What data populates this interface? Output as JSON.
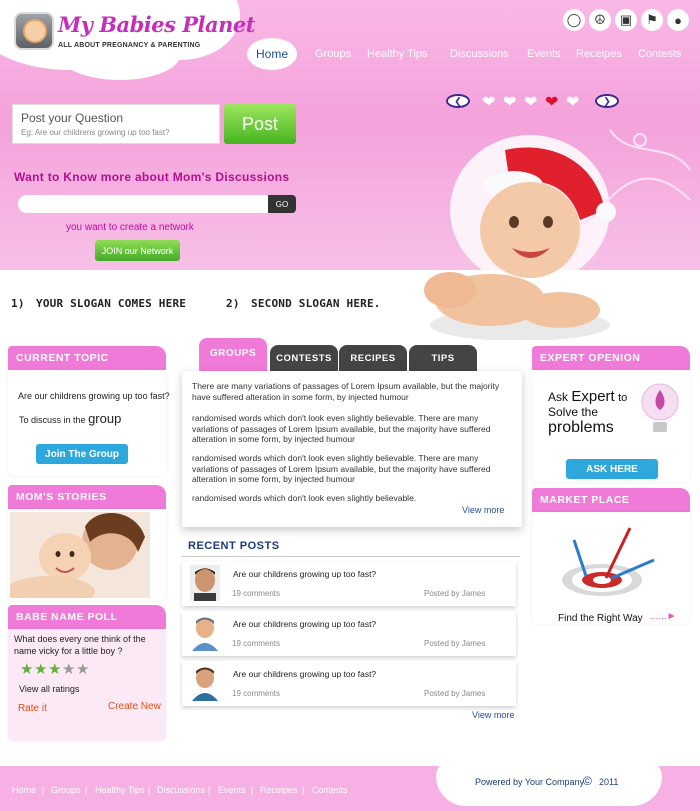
{
  "brand": {
    "title": "My Babies Planet",
    "tagline": "ALL ABOUT PREGNANCY & PARENTING",
    "pink": "#f07ad8",
    "blue_link": "#2a4e96"
  },
  "nav": {
    "items": [
      "Home",
      "Groups",
      "Healthy Tips",
      "Discussions",
      "Events",
      "Receipes",
      "Contests"
    ],
    "active": "Home"
  },
  "top_icons": [
    "bulb-icon",
    "peace-icon",
    "lock-icon",
    "flag-icon",
    "globe-icon"
  ],
  "question": {
    "label": "Post your Question",
    "hint": "Eg: Are our childrens growing up too fast?",
    "button": "Post"
  },
  "discussions": {
    "heading": "Want to Know more about Mom's Discussions",
    "input_value": "",
    "go_label": "GO",
    "network_text": "you want to create a network",
    "join_label": "JOIN our Network"
  },
  "slider": {
    "prev_icon": "chevron-left-icon",
    "next_icon": "chevron-right-icon",
    "hearts_total": 5,
    "active_index": 3
  },
  "slogans": {
    "one_num": "1)",
    "one": "YOUR SLOGAN COMES HERE",
    "two_num": "2)",
    "two": "SECOND SLOGAN HERE."
  },
  "current_topic": {
    "heading": "CURRENT TOPIC",
    "question": "Are our childrens growing up too fast?",
    "discuss_prefix": "To discuss in the",
    "discuss_word": "group",
    "button": "Join The Group"
  },
  "moms_stories": {
    "heading": "MOM'S STORIES"
  },
  "poll": {
    "heading": "BABE  NAME POLL",
    "question": "What does every one think of the name vicky for a little boy ?",
    "rating": 3,
    "rating_max": 5,
    "view_all": "View all ratings",
    "rate_it": "Rate it",
    "create_new": "Create New"
  },
  "tabs": [
    "GROUPS",
    "CONTESTS",
    "RECIPES",
    "TIPS"
  ],
  "content": {
    "paragraphs": [
      "There are many variations of passages of Lorem Ipsum available, but the majority have suffered alteration in some form, by injected humour",
      "randomised words which don't look even slightly believable. There are many variations of passages of Lorem Ipsum available, but the majority have suffered alteration in some form, by injected humour",
      "randomised words which don't look even slightly believable. There are many variations of passages of Lorem Ipsum available, but the majority have suffered alteration in some form, by injected humour",
      "randomised words which don't look even slightly believable."
    ],
    "view_more": "View more"
  },
  "recent_posts": {
    "heading": "RECENT POSTS",
    "items": [
      {
        "title": "Are our childrens growing up too fast?",
        "comments": "19 comments",
        "posted_by": "Posted by James"
      },
      {
        "title": "Are our childrens growing up too fast?",
        "comments": "19 comments",
        "posted_by": "Posted by James"
      },
      {
        "title": "Are our childrens growing up too fast?",
        "comments": "19 comments",
        "posted_by": "Posted by James"
      }
    ],
    "view_more": "View more"
  },
  "expert": {
    "heading": "EXPERT OPENION",
    "ask_1": "Ask",
    "ask_2": "Expert",
    "ask_3": "to",
    "solve": "Solve the",
    "problems": "problems",
    "button": "ASK HERE"
  },
  "market": {
    "heading": "MARKET PLACE",
    "caption": "Find the Right Way",
    "dots": "......"
  },
  "footer": {
    "links": [
      "Home",
      "Groups",
      "Healthy Tips",
      "Discussions",
      "Events",
      "Receipes",
      "Contests"
    ],
    "separator": "|",
    "powered": "Powered by Your Company",
    "copy_symbol": "©",
    "year": "2011"
  }
}
